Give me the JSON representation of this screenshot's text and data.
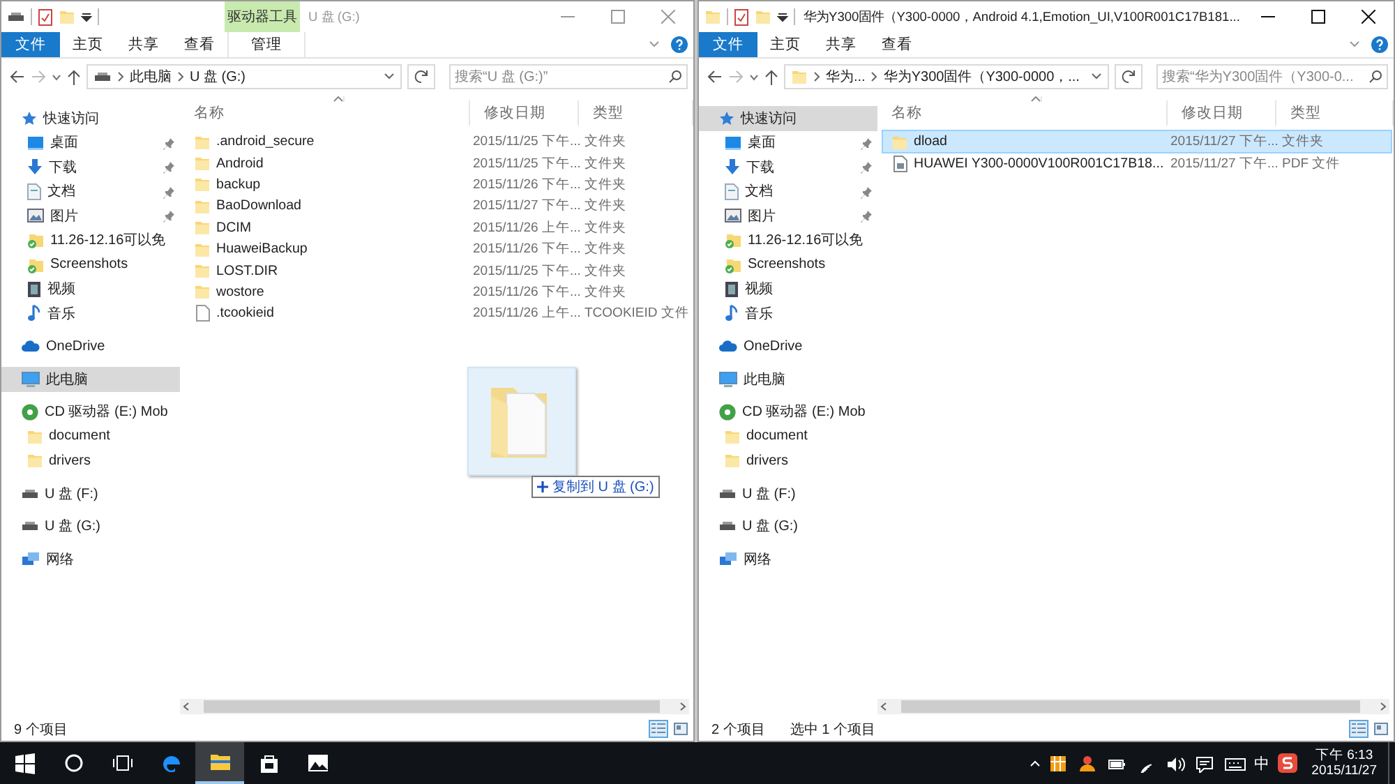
{
  "windows": [
    {
      "active": false,
      "title": "U 盘 (G:)",
      "context_group": {
        "title": "驱动器工具",
        "tab": "管理"
      },
      "quick_access_toolbar": [
        {
          "kind": "drive"
        },
        {
          "kind": "properties"
        },
        {
          "kind": "folder"
        }
      ],
      "ribbon_tabs": [
        {
          "label": "文件",
          "kind": "file",
          "selected": false
        },
        {
          "label": "主页",
          "kind": "plain",
          "selected": false
        },
        {
          "label": "共享",
          "kind": "plain",
          "selected": false
        },
        {
          "label": "查看",
          "kind": "plain",
          "selected": false
        }
      ],
      "address": {
        "kind": "drive",
        "crumbs": [
          "此电脑",
          "U 盘 (G:)"
        ]
      },
      "search": {
        "placeholder": "搜索“U 盘 (G:)”"
      },
      "sidebar": [
        {
          "label": "快速访问",
          "kind": "star",
          "selected": false,
          "children": [
            {
              "label": "桌面",
              "kind": "desktop",
              "pinned": true,
              "selected": false
            },
            {
              "label": "下载",
              "kind": "download",
              "pinned": true,
              "selected": false
            },
            {
              "label": "文档",
              "kind": "docs",
              "pinned": true,
              "selected": false
            },
            {
              "label": "图片",
              "kind": "pictures",
              "pinned": true,
              "selected": false
            },
            {
              "label": "11.26-12.16可以免",
              "kind": "syncfolder",
              "pinned": false,
              "selected": false
            },
            {
              "label": "Screenshots",
              "kind": "syncfolder",
              "pinned": false,
              "selected": false
            },
            {
              "label": "视频",
              "kind": "video",
              "pinned": false,
              "selected": false
            },
            {
              "label": "音乐",
              "kind": "music",
              "pinned": false,
              "selected": false
            }
          ]
        },
        {
          "label": "OneDrive",
          "kind": "cloud",
          "selected": false
        },
        {
          "label": "此电脑",
          "kind": "pc",
          "selected": true
        },
        {
          "label": "CD 驱动器 (E:) Mob",
          "kind": "cd",
          "selected": false,
          "children": [
            {
              "label": "document",
              "kind": "folder",
              "selected": false
            },
            {
              "label": "drivers",
              "kind": "folder",
              "selected": false
            }
          ]
        },
        {
          "label": "U 盘 (F:)",
          "kind": "drive",
          "selected": false
        },
        {
          "label": "U 盘 (G:)",
          "kind": "drive",
          "selected": false
        },
        {
          "label": "网络",
          "kind": "network",
          "selected": false
        }
      ],
      "columns": [
        "名称",
        "修改日期",
        "类型"
      ],
      "rows": [
        {
          "name": ".android_secure",
          "date": "2015/11/25 下午...",
          "type": "文件夹",
          "kind": "folder",
          "selected": false
        },
        {
          "name": "Android",
          "date": "2015/11/25 下午...",
          "type": "文件夹",
          "kind": "folder",
          "selected": false
        },
        {
          "name": "backup",
          "date": "2015/11/26 下午...",
          "type": "文件夹",
          "kind": "folder",
          "selected": false
        },
        {
          "name": "BaoDownload",
          "date": "2015/11/27 下午...",
          "type": "文件夹",
          "kind": "folder",
          "selected": false
        },
        {
          "name": "DCIM",
          "date": "2015/11/26 上午...",
          "type": "文件夹",
          "kind": "folder",
          "selected": false
        },
        {
          "name": "HuaweiBackup",
          "date": "2015/11/26 下午...",
          "type": "文件夹",
          "kind": "folder",
          "selected": false
        },
        {
          "name": "LOST.DIR",
          "date": "2015/11/25 下午...",
          "type": "文件夹",
          "kind": "folder",
          "selected": false
        },
        {
          "name": "wostore",
          "date": "2015/11/26 下午...",
          "type": "文件夹",
          "kind": "folder",
          "selected": false
        },
        {
          "name": ".tcookieid",
          "date": "2015/11/26 上午...",
          "type": "TCOOKIEID 文件",
          "kind": "file",
          "selected": false
        }
      ],
      "drag": {
        "tooltip": "复制到 U 盘 (G:)"
      },
      "status": [
        "9 个项目"
      ],
      "view_buttons": [
        {
          "kind": "details",
          "selected": true
        },
        {
          "kind": "tiles",
          "selected": false
        }
      ]
    },
    {
      "active": true,
      "title": "华为Y300固件（Y300-0000，Android 4.1,Emotion_UI,V100R001C17B181...",
      "quick_access_toolbar": [
        {
          "kind": "folder"
        },
        {
          "kind": "properties"
        },
        {
          "kind": "folder"
        }
      ],
      "ribbon_tabs": [
        {
          "label": "文件",
          "kind": "file",
          "selected": false
        },
        {
          "label": "主页",
          "kind": "plain",
          "selected": false
        },
        {
          "label": "共享",
          "kind": "plain",
          "selected": false
        },
        {
          "label": "查看",
          "kind": "plain",
          "selected": false
        }
      ],
      "address": {
        "kind": "folder",
        "crumbs": [
          "华为...",
          "华为Y300固件（Y300-0000，..."
        ]
      },
      "search": {
        "placeholder": "搜索“华为Y300固件（Y300-0..."
      },
      "sidebar": [
        {
          "label": "快速访问",
          "kind": "star",
          "selected": true,
          "children": [
            {
              "label": "桌面",
              "kind": "desktop",
              "pinned": true,
              "selected": false
            },
            {
              "label": "下载",
              "kind": "download",
              "pinned": true,
              "selected": false
            },
            {
              "label": "文档",
              "kind": "docs",
              "pinned": true,
              "selected": false
            },
            {
              "label": "图片",
              "kind": "pictures",
              "pinned": true,
              "selected": false
            },
            {
              "label": "11.26-12.16可以免",
              "kind": "syncfolder",
              "pinned": false,
              "selected": false
            },
            {
              "label": "Screenshots",
              "kind": "syncfolder",
              "pinned": false,
              "selected": false
            },
            {
              "label": "视频",
              "kind": "video",
              "pinned": false,
              "selected": false
            },
            {
              "label": "音乐",
              "kind": "music",
              "pinned": false,
              "selected": false
            }
          ]
        },
        {
          "label": "OneDrive",
          "kind": "cloud",
          "selected": false
        },
        {
          "label": "此电脑",
          "kind": "pc",
          "selected": false
        },
        {
          "label": "CD 驱动器 (E:) Mob",
          "kind": "cd",
          "selected": false,
          "children": [
            {
              "label": "document",
              "kind": "folder",
              "selected": false
            },
            {
              "label": "drivers",
              "kind": "folder",
              "selected": false
            }
          ]
        },
        {
          "label": "U 盘 (F:)",
          "kind": "drive",
          "selected": false
        },
        {
          "label": "U 盘 (G:)",
          "kind": "drive",
          "selected": false
        },
        {
          "label": "网络",
          "kind": "network",
          "selected": false
        }
      ],
      "columns": [
        "名称",
        "修改日期",
        "类型"
      ],
      "rows": [
        {
          "name": "dload",
          "date": "2015/11/27 下午...",
          "type": "文件夹",
          "kind": "folder",
          "selected": true
        },
        {
          "name": "HUAWEI Y300-0000V100R001C17B18...",
          "date": "2015/11/27 下午...",
          "type": "PDF 文件",
          "kind": "pdf",
          "selected": false
        }
      ],
      "status": [
        "2 个项目",
        "选中 1 个项目"
      ],
      "view_buttons": [
        {
          "kind": "details",
          "selected": true
        },
        {
          "kind": "tiles",
          "selected": false
        }
      ]
    }
  ],
  "taskbar": {
    "apps": [
      {
        "kind": "edge",
        "active": false
      },
      {
        "kind": "explorer",
        "active": true
      },
      {
        "kind": "store",
        "active": false
      },
      {
        "kind": "photos",
        "active": false
      }
    ],
    "tray": [
      {
        "kind": "orange"
      },
      {
        "kind": "person"
      },
      {
        "kind": "battery"
      },
      {
        "kind": "wifi"
      },
      {
        "kind": "volume"
      },
      {
        "kind": "message"
      },
      {
        "kind": "keyboard"
      }
    ],
    "input_method": "中",
    "clock_time": "下午 6:13",
    "clock_date": "2015/11/27"
  }
}
